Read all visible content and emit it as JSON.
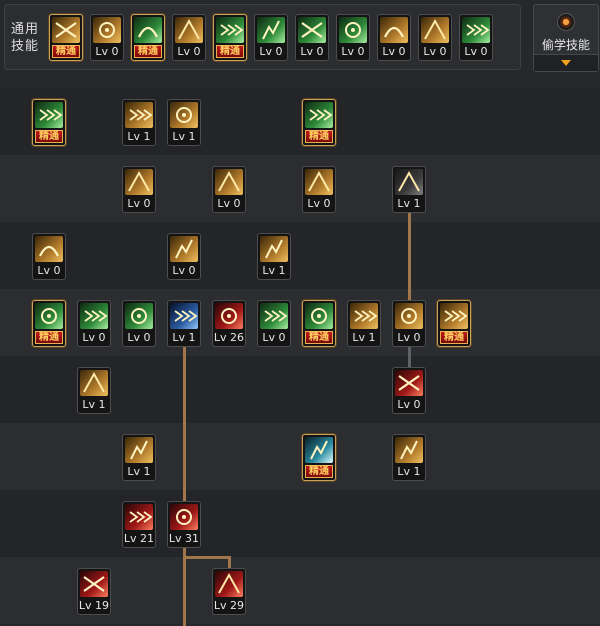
{
  "common_skills": {
    "label_line1": "通用",
    "label_line2": "技能",
    "slots": [
      {
        "icon": "sitting-figure-icon",
        "theme": "t-gold",
        "level": "",
        "mastered": true
      },
      {
        "icon": "slash-arc-icon",
        "theme": "t-gold",
        "level": "Lv 0",
        "mastered": false
      },
      {
        "icon": "running-figure-icon",
        "theme": "t-green",
        "level": "",
        "mastered": true
      },
      {
        "icon": "golden-wings-icon",
        "theme": "t-gold",
        "level": "Lv 0",
        "mastered": false
      },
      {
        "icon": "target-reticle-icon",
        "theme": "t-green",
        "level": "",
        "mastered": true
      },
      {
        "icon": "crosshair-icon",
        "theme": "t-green",
        "level": "Lv 0",
        "mastered": false
      },
      {
        "icon": "warrior-stance-icon",
        "theme": "t-green",
        "level": "Lv 0",
        "mastered": false
      },
      {
        "icon": "sword-guard-icon",
        "theme": "t-green",
        "level": "Lv 0",
        "mastered": false
      },
      {
        "icon": "vortex-swirl-icon",
        "theme": "t-gold",
        "level": "Lv 0",
        "mastered": false
      },
      {
        "icon": "golden-figure-icon",
        "theme": "t-gold",
        "level": "Lv 0",
        "mastered": false
      },
      {
        "icon": "fighter-pose-icon",
        "theme": "t-green",
        "level": "Lv 0",
        "mastered": false
      }
    ]
  },
  "steal_skill": {
    "label": "偷学技能"
  },
  "mastery_label": "精通",
  "skill_tree": [
    {
      "icon": "green-slash-text-icon",
      "theme": "t-green",
      "level": "",
      "mastered": true
    },
    {
      "icon": "crescent-slash-icon",
      "theme": "t-gold",
      "level": "Lv 1",
      "mastered": false
    },
    {
      "icon": "claw-slash-icon",
      "theme": "t-gold",
      "level": "Lv 1",
      "mastered": false
    },
    {
      "icon": "spinning-kick-icon",
      "theme": "t-green",
      "level": "",
      "mastered": true
    },
    {
      "icon": "burst-strike-icon",
      "theme": "t-gold",
      "level": "Lv 0",
      "mastered": false
    },
    {
      "icon": "triple-arrow-icon",
      "theme": "t-gold",
      "level": "Lv 0",
      "mastered": false
    },
    {
      "icon": "wave-sweep-icon",
      "theme": "t-gold",
      "level": "Lv 0",
      "mastered": false
    },
    {
      "icon": "cross-shield-icon",
      "theme": "t-shield",
      "level": "Lv 1",
      "mastered": false
    },
    {
      "icon": "lightning-dash-icon",
      "theme": "t-gold",
      "level": "Lv 0",
      "mastered": false
    },
    {
      "icon": "golden-ring-icon",
      "theme": "t-gold",
      "level": "Lv 0",
      "mastered": false
    },
    {
      "icon": "rising-strike-icon",
      "theme": "t-gold",
      "level": "Lv 1",
      "mastered": false
    },
    {
      "icon": "green-fist-icon",
      "theme": "t-green",
      "level": "",
      "mastered": true
    },
    {
      "icon": "green-blade-icon",
      "theme": "t-green",
      "level": "Lv 0",
      "mastered": false
    },
    {
      "icon": "green-sword-icon",
      "theme": "t-green",
      "level": "Lv 0",
      "mastered": false
    },
    {
      "icon": "blue-energy-slash-icon",
      "theme": "t-blue",
      "level": "Lv 1",
      "mastered": false
    },
    {
      "icon": "red-greatsword-icon",
      "theme": "t-red",
      "level": "Lv 26",
      "mastered": false
    },
    {
      "icon": "green-spark-icon",
      "theme": "t-green",
      "level": "Lv 0",
      "mastered": false
    },
    {
      "icon": "crossed-blades-icon",
      "theme": "t-green",
      "level": "",
      "mastered": true
    },
    {
      "icon": "golden-swoosh-icon",
      "theme": "t-gold",
      "level": "Lv 1",
      "mastered": false
    },
    {
      "icon": "golden-guard-icon",
      "theme": "t-gold",
      "level": "Lv 0",
      "mastered": false
    },
    {
      "icon": "golden-sword-cross-icon",
      "theme": "t-gold",
      "level": "",
      "mastered": true
    },
    {
      "icon": "gold-crescent-dash-icon",
      "theme": "t-gold",
      "level": "Lv 1",
      "mastered": false
    },
    {
      "icon": "red-shield-icon",
      "theme": "t-red",
      "level": "Lv 0",
      "mastered": false
    },
    {
      "icon": "gold-upper-slash-icon",
      "theme": "t-gold",
      "level": "Lv 1",
      "mastered": false
    },
    {
      "icon": "ice-burst-icon",
      "theme": "t-ice",
      "level": "",
      "mastered": true
    },
    {
      "icon": "gold-slash-lines-icon",
      "theme": "t-gold",
      "level": "Lv 1",
      "mastered": false
    },
    {
      "icon": "fire-streak-icon",
      "theme": "t-red",
      "level": "Lv 21",
      "mastered": false
    },
    {
      "icon": "red-warrior-swords-icon",
      "theme": "t-red",
      "level": "Lv 31",
      "mastered": false
    },
    {
      "icon": "red-crescent-icon",
      "theme": "t-red",
      "level": "Lv 19",
      "mastered": false
    },
    {
      "icon": "fire-bird-icon",
      "theme": "t-red",
      "level": "Lv 29",
      "mastered": false
    }
  ]
}
